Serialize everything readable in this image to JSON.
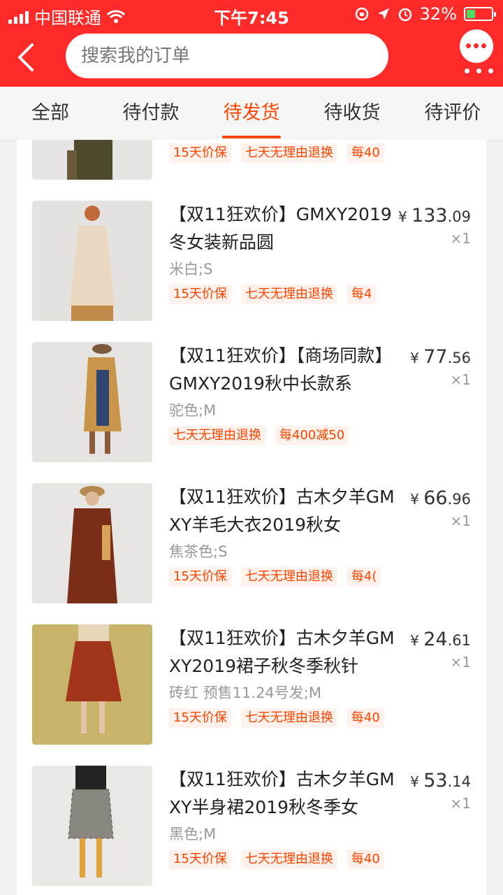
{
  "status": {
    "carrier": "中国联通",
    "time": "下午7:45",
    "battery": "32%",
    "battery_level": 0.32
  },
  "search": {
    "placeholder": "搜索我的订单"
  },
  "tabs": [
    {
      "label": "全部"
    },
    {
      "label": "待付款"
    },
    {
      "label": "待发货",
      "active": true
    },
    {
      "label": "待收货"
    },
    {
      "label": "待评价"
    }
  ],
  "items": [
    {
      "title": "",
      "spec": "",
      "tags": [
        "15天价保",
        "七天无理由退换",
        "每40"
      ],
      "price_int": "",
      "price_dec": "",
      "qty": "",
      "image": "dark-olive-dress-partial"
    },
    {
      "title": "【双11狂欢价】GMXY2019冬女装新品圆",
      "spec": "米白;S",
      "tags": [
        "15天价保",
        "七天无理由退换",
        "每4"
      ],
      "price_int": "133",
      "price_dec": ".09",
      "qty": "×1",
      "image": "beige-coat"
    },
    {
      "title": "【双11狂欢价】【商场同款】GMXY2019秋中长款系",
      "spec": "驼色;M",
      "tags": [
        "七天无理由退换",
        "每400减50"
      ],
      "price_int": "77",
      "price_dec": ".56",
      "qty": "×1",
      "image": "camel-trench"
    },
    {
      "title": "【双11狂欢价】古木夕羊GMXY羊毛大衣2019秋女",
      "spec": "焦茶色;S",
      "tags": [
        "15天价保",
        "七天无理由退换",
        "每4("
      ],
      "price_int": "66",
      "price_dec": ".96",
      "qty": "×1",
      "image": "brown-wool-coat"
    },
    {
      "title": "【双11狂欢价】古木夕羊GMXY2019裙子秋冬季秋针",
      "spec": "砖红 预售11.24号发;M",
      "tags": [
        "15天价保",
        "七天无理由退换",
        "每40"
      ],
      "price_int": "24",
      "price_dec": ".61",
      "qty": "×1",
      "image": "red-pleated-skirt"
    },
    {
      "title": "【双11狂欢价】古木夕羊GMXY半身裙2019秋冬季女",
      "spec": "黑色;M",
      "tags": [
        "15天价保",
        "七天无理由退换",
        "每40"
      ],
      "price_int": "53",
      "price_dec": ".14",
      "qty": "×1",
      "image": "grey-plaid-skirt"
    }
  ],
  "colors": {
    "brand_red": "#ff2a2a",
    "accent_orange": "#ff4400",
    "tag_bg": "#fff1eb"
  }
}
